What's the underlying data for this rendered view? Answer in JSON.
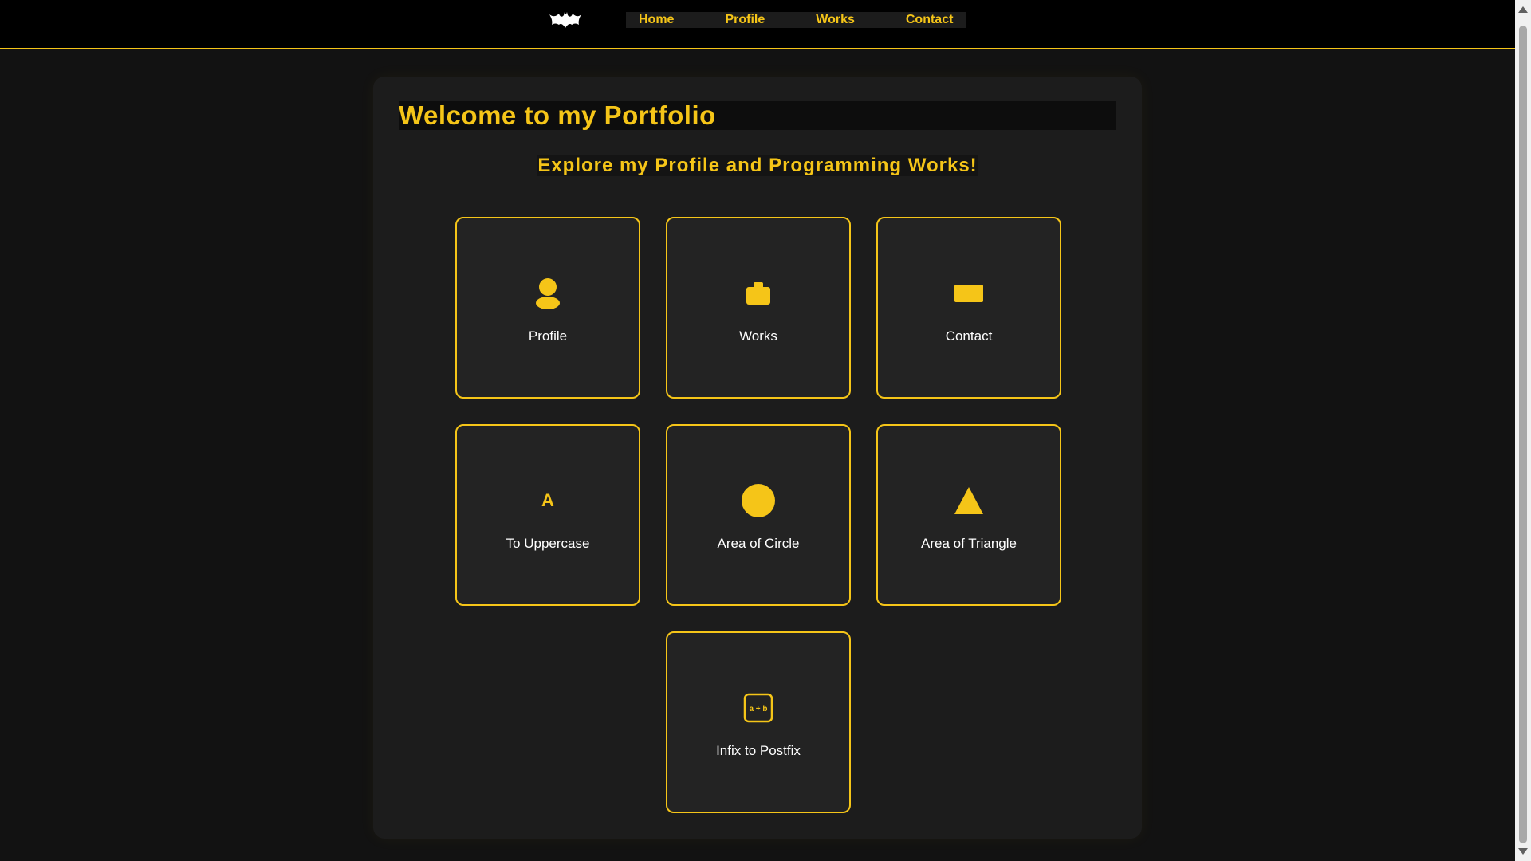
{
  "nav": {
    "logo": "bat-logo",
    "links": [
      "Home",
      "Profile",
      "Works",
      "Contact"
    ]
  },
  "main": {
    "title": "Welcome to my Portfolio",
    "subtitle": "Explore my Profile and Programming Works!",
    "cards": [
      {
        "label": "Profile",
        "icon": "user-icon"
      },
      {
        "label": "Works",
        "icon": "briefcase-icon"
      },
      {
        "label": "Contact",
        "icon": "envelope-icon"
      },
      {
        "label": "To Uppercase",
        "icon": "letter-a-icon",
        "icon_text": "A"
      },
      {
        "label": "Area of Circle",
        "icon": "circle-icon"
      },
      {
        "label": "Area of Triangle",
        "icon": "triangle-icon"
      },
      {
        "label": "Infix to Postfix",
        "icon": "formula-icon",
        "icon_text": "a + b"
      }
    ]
  },
  "colors": {
    "accent": "#f5c518",
    "background": "#121212",
    "panel": "#1c1c1c",
    "card": "#232323",
    "text": "#ffffff"
  }
}
